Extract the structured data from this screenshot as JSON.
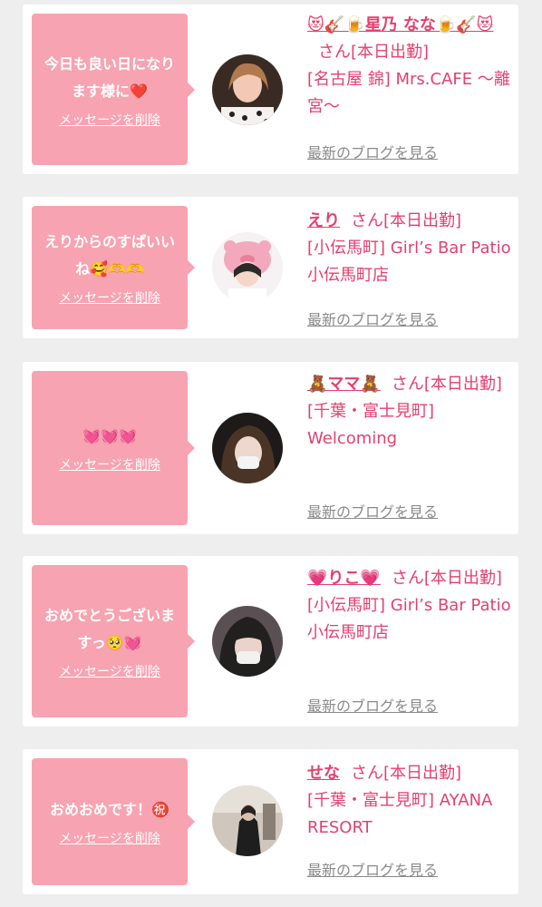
{
  "cards": [
    {
      "message": "今日も良い日になります様に❤️",
      "delete_label": "メッセージを削除",
      "name": "😻🎸🍺星乃 なな🍺🎸😻",
      "san_label": "さん[本日出勤]",
      "shop": "[名古屋 錦] Mrs.CAFE 〜離宮〜",
      "blog_label": "最新のブログを見る"
    },
    {
      "message": "えりからのすぱいいね🥰🫶🫶",
      "delete_label": "メッセージを削除",
      "name": "えり",
      "san_label": "さん[本日出勤]",
      "shop": "[小伝馬町] Girl’s Bar Patio 小伝馬町店",
      "blog_label": "最新のブログを見る"
    },
    {
      "message": "💓💓💓",
      "delete_label": "メッセージを削除",
      "name": "🧸ママ🧸",
      "san_label": "さん[本日出勤]",
      "shop": "[千葉・富士見町] Welcoming",
      "blog_label": "最新のブログを見る"
    },
    {
      "message": "おめでとうございますっ🥺💓",
      "delete_label": "メッセージを削除",
      "name": "💗りこ💗",
      "san_label": "さん[本日出勤]",
      "shop": "[小伝馬町] Girl’s Bar Patio 小伝馬町店",
      "blog_label": "最新のブログを見る"
    },
    {
      "message": "おめおめです！㊗️",
      "delete_label": "メッセージを削除",
      "name": "せな",
      "san_label": "さん[本日出勤]",
      "shop": "[千葉・富士見町] AYANA RESORT",
      "blog_label": "最新のブログを見る"
    }
  ]
}
